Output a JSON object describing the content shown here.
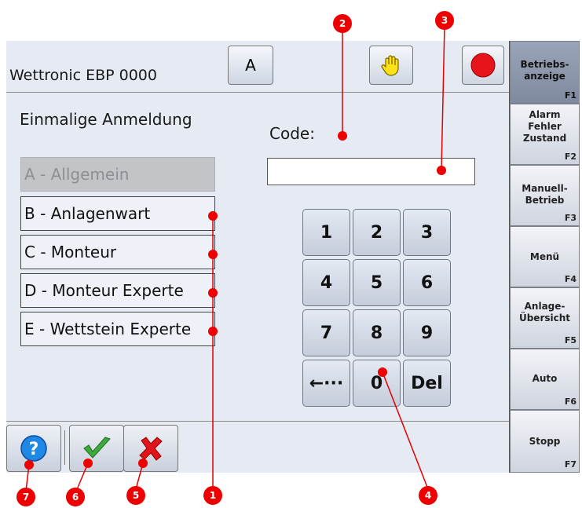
{
  "header": {
    "title": "Wettronic EBP 0000",
    "level_button": "A"
  },
  "login": {
    "title": "Einmalige Anmeldung",
    "levels": [
      {
        "label": "A - Allgemein",
        "enabled": false
      },
      {
        "label": "B - Anlagenwart",
        "enabled": true
      },
      {
        "label": "C - Monteur",
        "enabled": true
      },
      {
        "label": "D - Monteur Experte",
        "enabled": true
      },
      {
        "label": "E - Wettstein Experte",
        "enabled": true
      }
    ],
    "code_label": "Code:",
    "code_value": ""
  },
  "keypad": {
    "keys": [
      "1",
      "2",
      "3",
      "4",
      "5",
      "6",
      "7",
      "8",
      "9",
      "←···",
      "0",
      "Del"
    ]
  },
  "sidebar": {
    "buttons": [
      {
        "label": "Betriebs-\nanzeige",
        "fkey": "F1",
        "active": true
      },
      {
        "label": "Alarm\nFehler\nZustand",
        "fkey": "F2",
        "active": false
      },
      {
        "label": "Manuell-\nBetrieb",
        "fkey": "F3",
        "active": false
      },
      {
        "label": "Menü",
        "fkey": "F4",
        "active": false
      },
      {
        "label": "Anlage-\nÜbersicht",
        "fkey": "F5",
        "active": false
      },
      {
        "label": "Auto",
        "fkey": "F6",
        "active": false
      },
      {
        "label": "Stopp",
        "fkey": "F7",
        "active": false
      }
    ]
  },
  "footer": {
    "icons": [
      "help-icon",
      "confirm-check-icon",
      "cancel-x-icon"
    ]
  },
  "callouts": [
    "1",
    "2",
    "3",
    "4",
    "5",
    "6",
    "7"
  ],
  "colors": {
    "callout": "#e00000",
    "active_sidebar": "#8893a8",
    "background": "#e6eaf2"
  }
}
